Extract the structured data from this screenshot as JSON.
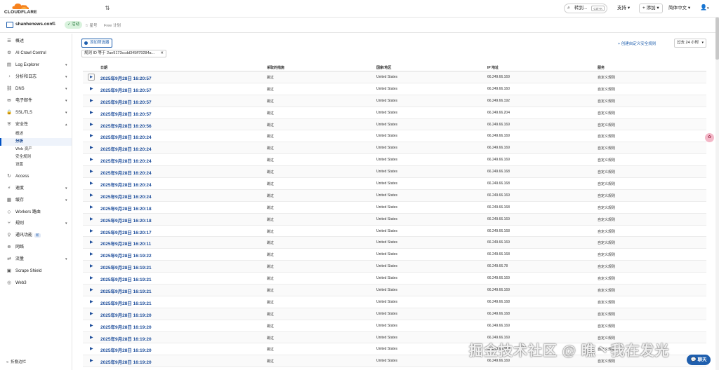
{
  "topbar": {
    "logo_text": "CLOUDFLARE",
    "search_label": "转到...",
    "search_kbd": "Ctrl+K",
    "support_label": "支持",
    "add_label": "添加",
    "lang_label": "简体中文",
    "caret": "▾",
    "user_icon": "user-icon"
  },
  "zone": {
    "name": "shanhenews.com",
    "status": "活动",
    "star_label": "星号",
    "plan_label": "Free 计划"
  },
  "sidebar": {
    "items": [
      {
        "label": "概述",
        "icon": "☰",
        "chev": ""
      },
      {
        "label": "AI Crawl Control",
        "icon": "⚙",
        "chev": ""
      },
      {
        "label": "Log Explorer",
        "icon": "▤",
        "chev": "▾"
      },
      {
        "label": "分析和日志",
        "icon": "◔",
        "chev": "▾"
      },
      {
        "label": "DNS",
        "icon": "⛓",
        "chev": "▾"
      },
      {
        "label": "电子邮件",
        "icon": "✉",
        "chev": "▾"
      },
      {
        "label": "SSL/TLS",
        "icon": "🔒",
        "chev": "▾"
      },
      {
        "label": "安全性",
        "icon": "⛨",
        "chev": "▴"
      }
    ],
    "sub_items": [
      "概述",
      "分析",
      "Web 资产",
      "安全规则",
      "设置"
    ],
    "items_after": [
      {
        "label": "Access",
        "icon": "↻",
        "chev": ""
      },
      {
        "label": "速度",
        "icon": "⚡",
        "chev": "▾"
      },
      {
        "label": "缓存",
        "icon": "▦",
        "chev": "▾"
      },
      {
        "label": "Workers 路由",
        "icon": "◇",
        "chev": ""
      },
      {
        "label": "规则",
        "icon": "⑂",
        "chev": "▾"
      },
      {
        "label": "通讯功能",
        "icon": "⚲",
        "chev": "",
        "badge": "新"
      },
      {
        "label": "网络",
        "icon": "⊕",
        "chev": ""
      },
      {
        "label": "流量",
        "icon": "⇄",
        "chev": "▾"
      },
      {
        "label": "Scrape Shield",
        "icon": "▣",
        "chev": ""
      },
      {
        "label": "Web3",
        "icon": "◎",
        "chev": ""
      }
    ],
    "collapse_label": "折叠边栏"
  },
  "filters": {
    "add_filter": "添加筛选器",
    "chip": "规则 ID 等于 2ae9173ccdd345ff79284a...",
    "create_rule": "+ 创建自定义安全规则",
    "time_range": "过去 24 小时"
  },
  "table": {
    "headers": [
      "日期",
      "采取的措施",
      "国家/地区",
      "IP 地址",
      "服务"
    ],
    "rows": [
      [
        "2025年9月28日 16:20:57",
        "跳过",
        "United States",
        "66.249.66.169",
        "自定义规则"
      ],
      [
        "2025年9月28日 16:20:57",
        "跳过",
        "United States",
        "66.249.66.160",
        "自定义规则"
      ],
      [
        "2025年9月28日 16:20:57",
        "跳过",
        "United States",
        "66.249.66.192",
        "自定义规则"
      ],
      [
        "2025年9月28日 16:20:57",
        "跳过",
        "United States",
        "66.249.66.204",
        "自定义规则"
      ],
      [
        "2025年9月28日 16:20:56",
        "跳过",
        "United States",
        "66.249.66.169",
        "自定义规则"
      ],
      [
        "2025年9月28日 16:20:24",
        "跳过",
        "United States",
        "66.249.66.169",
        "自定义规则"
      ],
      [
        "2025年9月28日 16:20:24",
        "跳过",
        "United States",
        "66.249.66.169",
        "自定义规则"
      ],
      [
        "2025年9月28日 16:20:24",
        "跳过",
        "United States",
        "66.249.66.169",
        "自定义规则"
      ],
      [
        "2025年9月28日 16:20:24",
        "跳过",
        "United States",
        "66.249.66.168",
        "自定义规则"
      ],
      [
        "2025年9月28日 16:20:24",
        "跳过",
        "United States",
        "66.249.66.168",
        "自定义规则"
      ],
      [
        "2025年9月28日 16:20:24",
        "跳过",
        "United States",
        "66.249.66.169",
        "自定义规则"
      ],
      [
        "2025年9月28日 16:20:18",
        "跳过",
        "United States",
        "66.249.66.168",
        "自定义规则"
      ],
      [
        "2025年9月28日 16:20:18",
        "跳过",
        "United States",
        "66.249.66.169",
        "自定义规则"
      ],
      [
        "2025年9月28日 16:20:17",
        "跳过",
        "United States",
        "66.249.66.168",
        "自定义规则"
      ],
      [
        "2025年9月28日 16:20:11",
        "跳过",
        "United States",
        "66.249.66.169",
        "自定义规则"
      ],
      [
        "2025年9月28日 16:19:22",
        "跳过",
        "United States",
        "66.249.66.168",
        "自定义规则"
      ],
      [
        "2025年9月28日 16:19:21",
        "跳过",
        "United States",
        "66.249.66.78",
        "自定义规则"
      ],
      [
        "2025年9月28日 16:19:21",
        "跳过",
        "United States",
        "66.249.66.169",
        "自定义规则"
      ],
      [
        "2025年9月28日 16:19:21",
        "跳过",
        "United States",
        "66.249.66.169",
        "自定义规则"
      ],
      [
        "2025年9月28日 16:19:21",
        "跳过",
        "United States",
        "66.249.66.168",
        "自定义规则"
      ],
      [
        "2025年9月28日 16:19:20",
        "跳过",
        "United States",
        "66.249.66.168",
        "自定义规则"
      ],
      [
        "2025年9月28日 16:19:20",
        "跳过",
        "United States",
        "66.249.66.169",
        "自定义规则"
      ],
      [
        "2025年9月28日 16:19:20",
        "跳过",
        "United States",
        "66.249.66.169",
        "自定义规则"
      ],
      [
        "2025年9月28日 16:19:20",
        "跳过",
        "United States",
        "66.249.66.169",
        "自定义规则"
      ],
      [
        "2025年9月28日 16:19:20",
        "跳过",
        "United States",
        "66.249.66.169",
        "自定义规则"
      ]
    ]
  },
  "overlay": {
    "watermark": "掘金技术社区 @ 瞧丶我在发光",
    "chat_label": "聊天"
  },
  "colors": {
    "accent": "#1f5fae",
    "brand_orange": "#f6821f",
    "active_badge": "#d9f2dd"
  }
}
